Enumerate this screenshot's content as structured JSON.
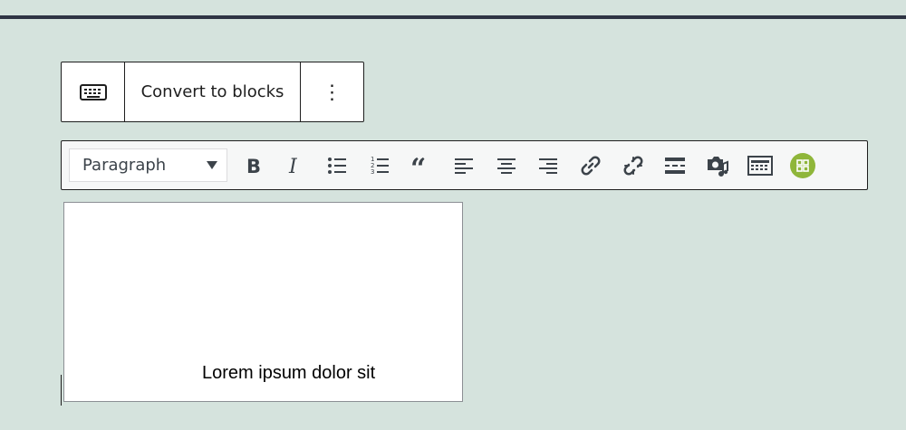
{
  "block_toolbar": {
    "convert_label": "Convert to blocks",
    "more_label": "⋮",
    "keyboard_icon": "keyboard-icon"
  },
  "format_toolbar": {
    "format_select_value": "Paragraph",
    "buttons": [
      {
        "name": "bold-icon"
      },
      {
        "name": "italic-icon"
      },
      {
        "name": "bulleted-list-icon"
      },
      {
        "name": "numbered-list-icon"
      },
      {
        "name": "blockquote-icon"
      },
      {
        "name": "align-left-icon"
      },
      {
        "name": "align-center-icon"
      },
      {
        "name": "align-right-icon"
      },
      {
        "name": "insert-link-icon"
      },
      {
        "name": "remove-link-icon"
      },
      {
        "name": "read-more-icon"
      },
      {
        "name": "add-media-icon"
      },
      {
        "name": "toolbar-toggle-icon"
      },
      {
        "name": "plugin-grid-icon"
      }
    ]
  },
  "editor": {
    "content": "Lorem ipsum dolor sit"
  },
  "colors": {
    "background": "#d5e3dd",
    "plugin_badge": "#8fb63a"
  }
}
